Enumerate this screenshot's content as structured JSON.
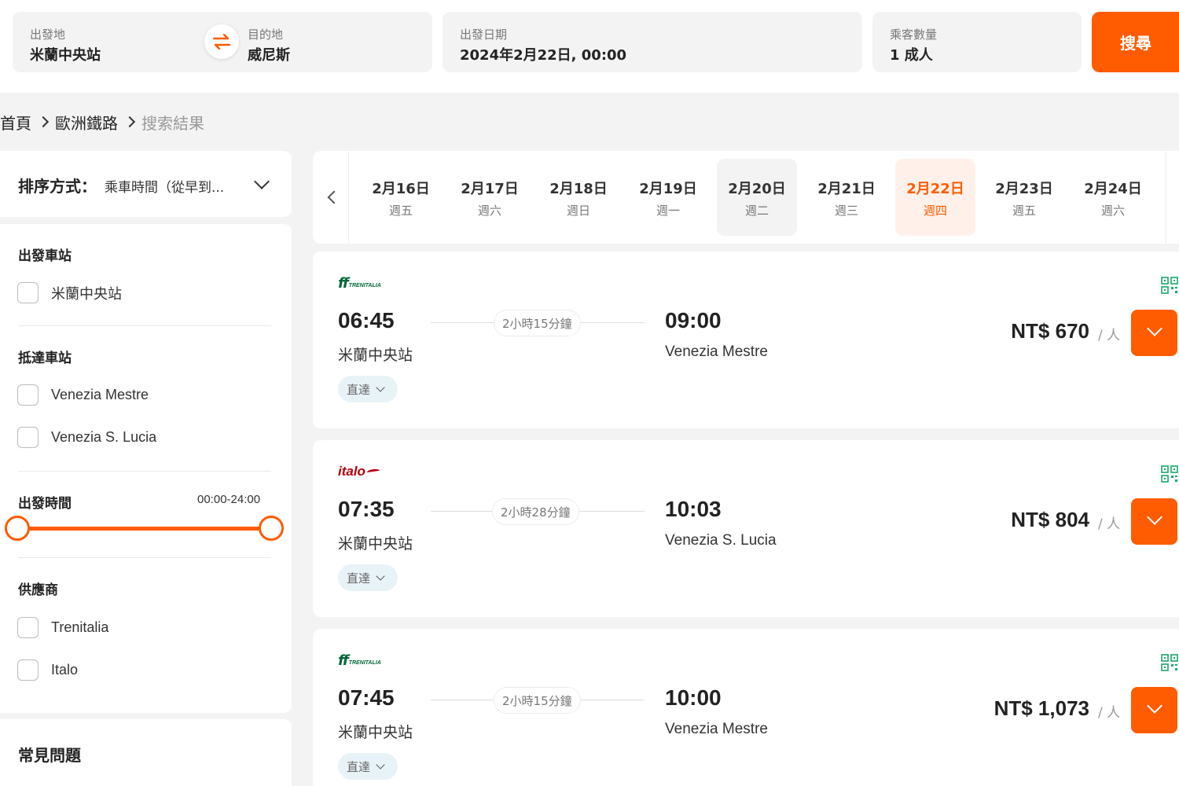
{
  "search": {
    "origin_label": "出發地",
    "origin_value": "米蘭中央站",
    "destination_label": "目的地",
    "destination_value": "威尼斯",
    "date_label": "出發日期",
    "date_value": "2024年2月22日, 00:00",
    "passengers_label": "乘客數量",
    "passengers_value": "1 成人",
    "search_button": "搜尋",
    "accent_color": "#ff5b00",
    "swap_icon": "swap-arrows-icon"
  },
  "breadcrumb": {
    "items": [
      "首頁",
      "歐洲鐵路"
    ],
    "current": "搜索結果"
  },
  "sort": {
    "label": "排序方式：",
    "value": "乘車時間（從早到..."
  },
  "filters": {
    "departure_station": {
      "title": "出發車站",
      "options": [
        "米蘭中央站"
      ]
    },
    "arrival_station": {
      "title": "抵達車站",
      "options": [
        "Venezia Mestre",
        "Venezia S. Lucia"
      ]
    },
    "departure_time": {
      "title": "出發時間",
      "range": "00:00-24:00"
    },
    "provider": {
      "title": "供應商",
      "options": [
        "Trenitalia",
        "Italo"
      ]
    }
  },
  "faq": {
    "title": "常見問題"
  },
  "dates": [
    {
      "date": "2月16日",
      "weekday": "週五"
    },
    {
      "date": "2月17日",
      "weekday": "週六"
    },
    {
      "date": "2月18日",
      "weekday": "週日"
    },
    {
      "date": "2月19日",
      "weekday": "週一"
    },
    {
      "date": "2月20日",
      "weekday": "週二"
    },
    {
      "date": "2月21日",
      "weekday": "週三"
    },
    {
      "date": "2月22日",
      "weekday": "週四"
    },
    {
      "date": "2月23日",
      "weekday": "週五"
    },
    {
      "date": "2月24日",
      "weekday": "週六"
    }
  ],
  "selected_date": "2月22日",
  "trains": [
    {
      "operator": "Trenitalia",
      "logo_text": "TRENITALIA",
      "depart_time": "06:45",
      "depart_station": "米蘭中央站",
      "duration": "2小時15分鐘",
      "arrive_time": "09:00",
      "arrive_station": "Venezia Mestre",
      "stops": "直達",
      "price": "NT$ 670",
      "per": "/ 人"
    },
    {
      "operator": "Italo",
      "logo_text": "italo",
      "depart_time": "07:35",
      "depart_station": "米蘭中央站",
      "duration": "2小時28分鐘",
      "arrive_time": "10:03",
      "arrive_station": "Venezia S. Lucia",
      "stops": "直達",
      "price": "NT$ 804",
      "per": "/ 人"
    },
    {
      "operator": "Trenitalia",
      "logo_text": "TRENITALIA",
      "depart_time": "07:45",
      "depart_station": "米蘭中央站",
      "duration": "2小時15分鐘",
      "arrive_time": "10:00",
      "arrive_station": "Venezia Mestre",
      "stops": "直達",
      "price": "NT$ 1,073",
      "per": "/ 人"
    }
  ]
}
